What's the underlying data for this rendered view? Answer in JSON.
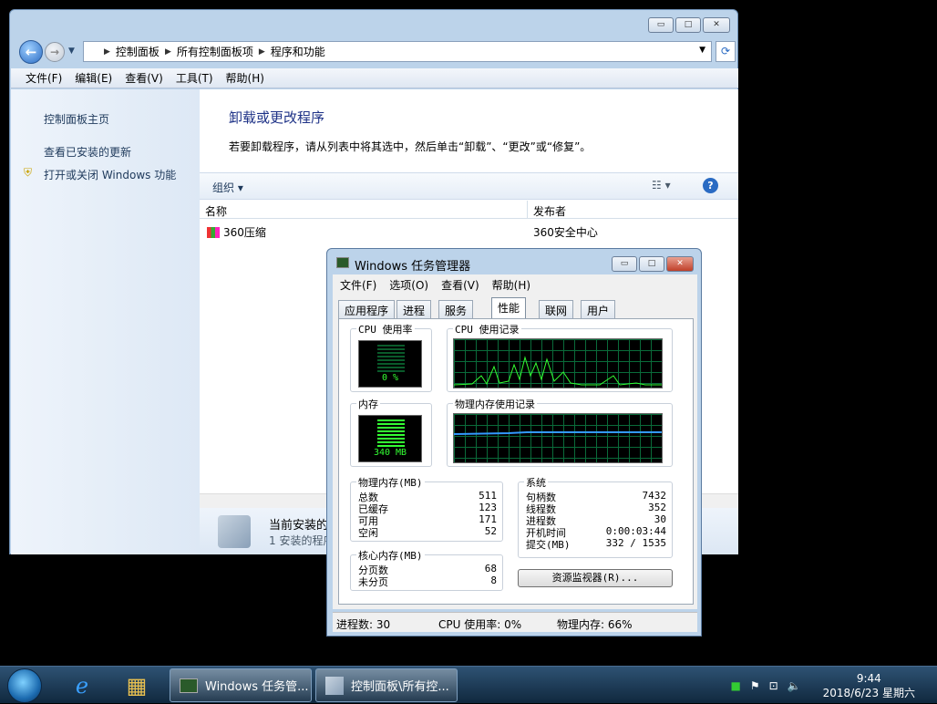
{
  "control_panel": {
    "caption_buttons": {
      "minimize": "▭",
      "maximize": "□",
      "close": "✕"
    },
    "breadcrumb": [
      "控制面板",
      "所有控制面板项",
      "程序和功能"
    ],
    "menus": [
      "文件(F)",
      "编辑(E)",
      "查看(V)",
      "工具(T)",
      "帮助(H)"
    ],
    "left_links": [
      "控制面板主页",
      "查看已安装的更新",
      "打开或关闭 Windows 功能"
    ],
    "title": "卸载或更改程序",
    "description": "若要卸载程序，请从列表中将其选中，然后单击“卸载”、“更改”或“修复”。",
    "organize": "组织",
    "columns": [
      "名称",
      "发布者"
    ],
    "programs": [
      {
        "name": "360压缩",
        "publisher": "360安全中心"
      }
    ],
    "info_title": "当前安装的",
    "info_sub": "1 安装的程序"
  },
  "task_manager": {
    "title": "Windows 任务管理器",
    "menus": [
      "文件(F)",
      "选项(O)",
      "查看(V)",
      "帮助(H)"
    ],
    "tabs": [
      "应用程序",
      "进程",
      "服务",
      "性能",
      "联网",
      "用户"
    ],
    "active_tab": "性能",
    "cpu_usage_label": "CPU 使用率",
    "cpu_usage_value": "0 %",
    "cpu_history_label": "CPU 使用记录",
    "memory_label": "内存",
    "memory_value": "340 MB",
    "memory_history_label": "物理内存使用记录",
    "physical_memory": {
      "label": "物理内存(MB)",
      "rows": [
        [
          "总数",
          "511"
        ],
        [
          "已缓存",
          "123"
        ],
        [
          "可用",
          "171"
        ],
        [
          "空闲",
          "52"
        ]
      ]
    },
    "kernel_memory": {
      "label": "核心内存(MB)",
      "rows": [
        [
          "分页数",
          "68"
        ],
        [
          "未分页",
          "8"
        ]
      ]
    },
    "system": {
      "label": "系统",
      "rows": [
        [
          "句柄数",
          "7432"
        ],
        [
          "线程数",
          "352"
        ],
        [
          "进程数",
          "30"
        ],
        [
          "开机时间",
          "0:00:03:44"
        ],
        [
          "提交(MB)",
          "332 / 1535"
        ]
      ]
    },
    "resource_monitor_button": "资源监视器(R)...",
    "status": {
      "processes": "进程数: 30",
      "cpu": "CPU 使用率: 0%",
      "memory": "物理内存: 66%"
    }
  },
  "taskbar": {
    "buttons": [
      "Windows 任务管...",
      "控制面板\\所有控..."
    ],
    "time": "9:44",
    "date": "2018/6/23 星期六"
  }
}
